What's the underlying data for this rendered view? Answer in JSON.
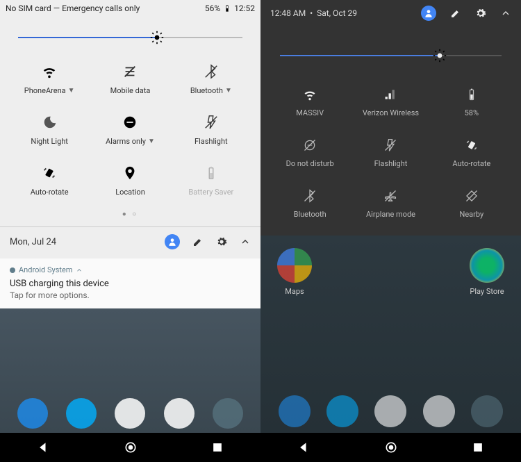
{
  "left": {
    "status": {
      "sim": "No SIM card — Emergency calls only",
      "battery": "56%",
      "time": "12:52"
    },
    "brightness_pct": 62,
    "tiles": [
      {
        "label": "PhoneArena",
        "dropdown": true,
        "icon": "wifi"
      },
      {
        "label": "Mobile data",
        "icon": "mobiledata-off"
      },
      {
        "label": "Bluetooth",
        "dropdown": true,
        "icon": "bluetooth-off"
      },
      {
        "label": "Night Light",
        "icon": "moon"
      },
      {
        "label": "Alarms only",
        "dropdown": true,
        "icon": "dnd"
      },
      {
        "label": "Flashlight",
        "icon": "flashlight-off"
      },
      {
        "label": "Auto-rotate",
        "icon": "autorotate"
      },
      {
        "label": "Location",
        "icon": "location"
      },
      {
        "label": "Battery Saver",
        "icon": "battery",
        "dim": true
      }
    ],
    "date": "Mon, Jul 24",
    "notification": {
      "source": "Android System",
      "title": "USB charging this device",
      "body": "Tap for more options."
    }
  },
  "right": {
    "status": {
      "time": "12:48 AM",
      "date": "Sat, Oct 29"
    },
    "brightness_pct": 72,
    "tiles": [
      {
        "label": "MASSIV",
        "icon": "wifi"
      },
      {
        "label": "Verizon Wireless",
        "icon": "signal"
      },
      {
        "label": "58%",
        "icon": "battery"
      },
      {
        "label": "Do not disturb",
        "icon": "dnd-off"
      },
      {
        "label": "Flashlight",
        "icon": "flashlight-off"
      },
      {
        "label": "Auto-rotate",
        "icon": "autorotate"
      },
      {
        "label": "Bluetooth",
        "icon": "bluetooth-off"
      },
      {
        "label": "Airplane mode",
        "icon": "airplane-off"
      },
      {
        "label": "Nearby",
        "icon": "nearby-off"
      }
    ],
    "apps": {
      "maps": "Maps",
      "playstore": "Play Store"
    }
  }
}
